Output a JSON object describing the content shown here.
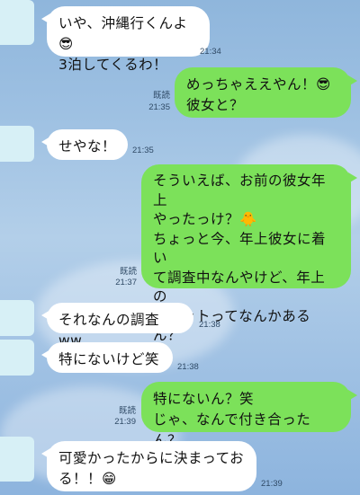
{
  "messages": [
    {
      "side": "left",
      "text": "いや、沖縄行くんよ😎\n3泊してくるわ！",
      "time": "21:34"
    },
    {
      "side": "right",
      "text": "めっちゃええやん！😎\n彼女と？",
      "read": "既読",
      "time": "21:35"
    },
    {
      "side": "left",
      "text": "せやな！",
      "time": "21:35"
    },
    {
      "side": "right",
      "text": "そういえば、お前の彼女年上\nやったっけ？🐥\nちょっと今、年上彼女に着い\nて調査中なんやけど、年上の\nメリットってなんかあるん？\n笑",
      "read": "既読",
      "time": "21:37"
    },
    {
      "side": "left",
      "text": "それなんの調査ww",
      "time": "21:38"
    },
    {
      "side": "left",
      "text": "特にないけど笑",
      "time": "21:38"
    },
    {
      "side": "right",
      "text": "特にないん？笑\nじゃ、なんで付き合ったん？",
      "read": "既読",
      "time": "21:39"
    },
    {
      "side": "left",
      "text": "可愛かったからに決まっておる！！😁",
      "time": "21:39"
    }
  ]
}
